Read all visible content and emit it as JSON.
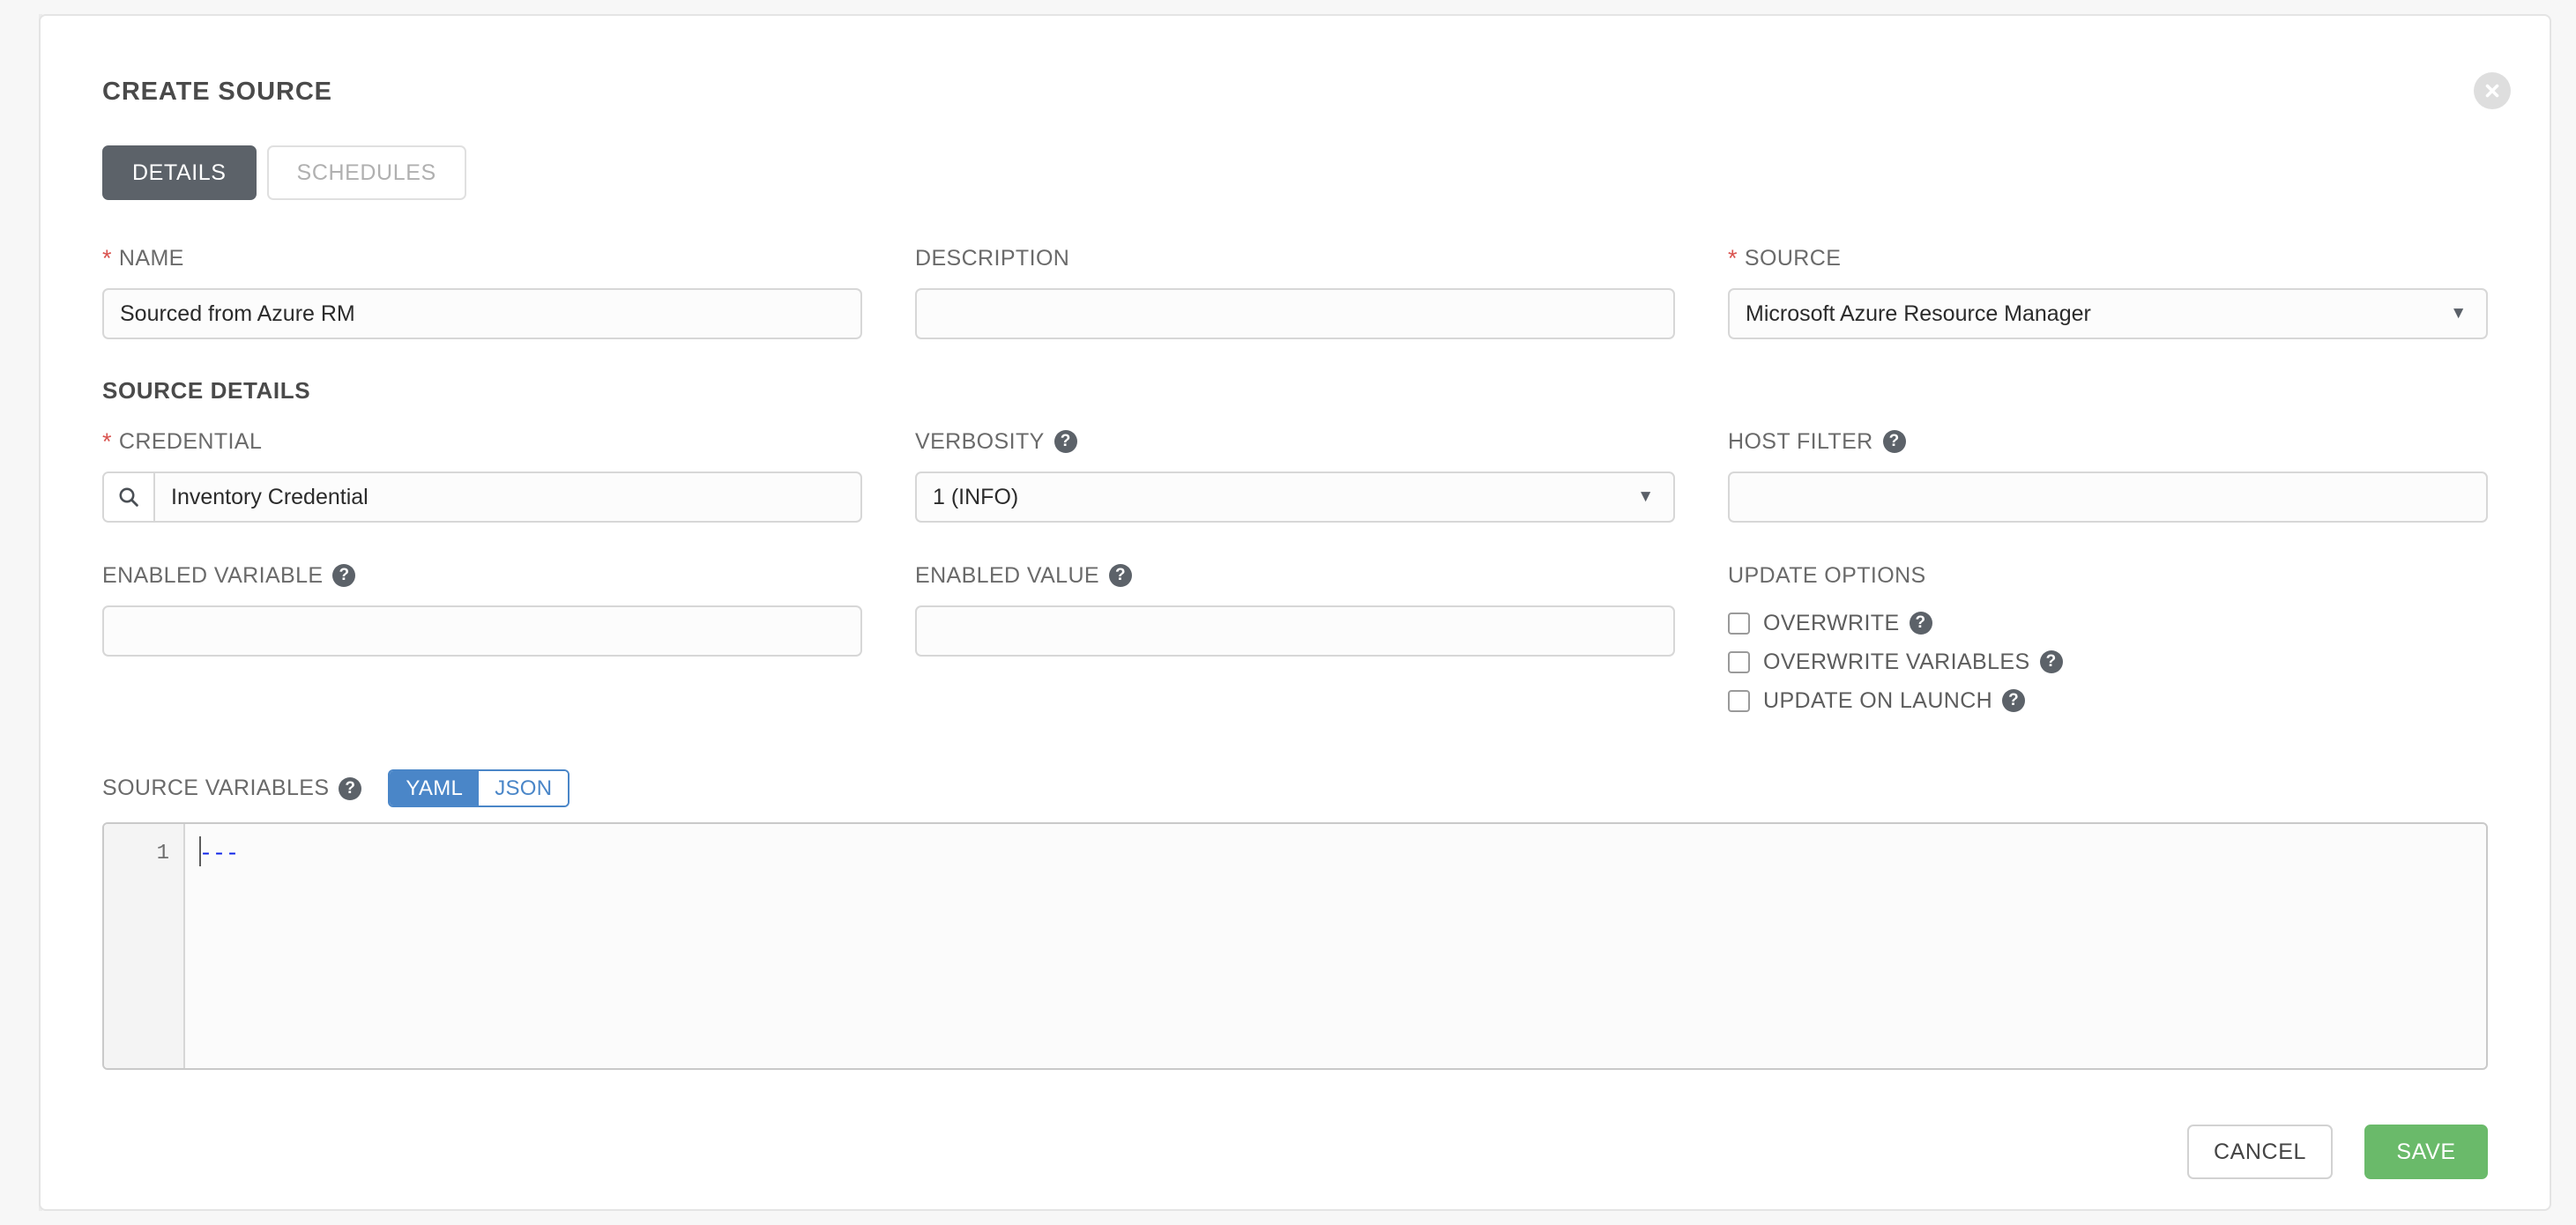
{
  "modal": {
    "title": "CREATE SOURCE",
    "close_icon": "close-icon"
  },
  "tabs": [
    {
      "label": "DETAILS",
      "active": true
    },
    {
      "label": "SCHEDULES",
      "active": false
    }
  ],
  "fields": {
    "name": {
      "label": "NAME",
      "required": true,
      "value": "Sourced from Azure RM"
    },
    "description": {
      "label": "DESCRIPTION",
      "required": false,
      "value": ""
    },
    "source": {
      "label": "SOURCE",
      "required": true,
      "value": "Microsoft Azure Resource Manager"
    },
    "credential": {
      "label": "CREDENTIAL",
      "required": true,
      "value": "Inventory Credential",
      "icon": "search-icon"
    },
    "verbosity": {
      "label": "VERBOSITY",
      "required": false,
      "value": "1 (INFO)",
      "help": true
    },
    "host_filter": {
      "label": "HOST FILTER",
      "required": false,
      "value": "",
      "help": true
    },
    "enabled_variable": {
      "label": "ENABLED VARIABLE",
      "required": false,
      "value": "",
      "help": true
    },
    "enabled_value": {
      "label": "ENABLED VALUE",
      "required": false,
      "value": "",
      "help": true
    }
  },
  "section": {
    "source_details_heading": "SOURCE DETAILS"
  },
  "update_options": {
    "heading": "UPDATE OPTIONS",
    "items": [
      {
        "label": "OVERWRITE",
        "checked": false,
        "help": true
      },
      {
        "label": "OVERWRITE VARIABLES",
        "checked": false,
        "help": true
      },
      {
        "label": "UPDATE ON LAUNCH",
        "checked": false,
        "help": true
      }
    ]
  },
  "source_variables": {
    "label": "SOURCE VARIABLES",
    "help": true,
    "format_yaml": "YAML",
    "format_json": "JSON",
    "active_format": "YAML",
    "line_number": "1",
    "content": "---"
  },
  "footer": {
    "cancel_label": "CANCEL",
    "save_label": "SAVE"
  },
  "help_glyph": "?",
  "caret_glyph": "▼",
  "colors": {
    "accent_blue": "#4a86c8",
    "save_green": "#6aba6a",
    "required_red": "#d9534f",
    "tab_active_bg": "#5c6269",
    "code_blue": "#0b21e8"
  }
}
